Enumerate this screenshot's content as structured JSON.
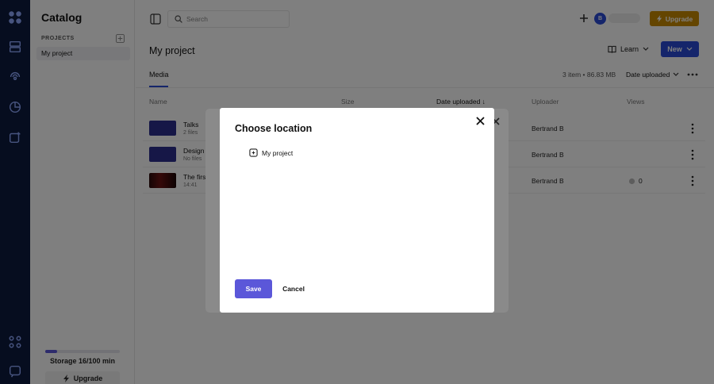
{
  "app": {
    "name": "Catalog"
  },
  "sidebar": {
    "projects_label": "PROJECTS",
    "project": "My project",
    "storage": {
      "label": "Storage 16/100 min",
      "used_fraction": 0.16
    },
    "upgrade_label": "Upgrade"
  },
  "topbar": {
    "search_placeholder": "Search",
    "avatar_initial": "B",
    "upgrade_label": "Upgrade"
  },
  "main": {
    "title": "My project",
    "learn_label": "Learn",
    "new_label": "New",
    "tab": "Media",
    "summary": "3 item • 86.83 MB",
    "sort_label": "Date uploaded",
    "columns": [
      "Name",
      "Size",
      "Date uploaded",
      "Uploader",
      "Views"
    ],
    "rows": [
      {
        "name": "Talks",
        "sub": "2 files",
        "uploader": "Bertrand B",
        "views": "",
        "kind": "folder"
      },
      {
        "name": "Design",
        "sub": "No files",
        "uploader": "Bertrand B",
        "views": "",
        "kind": "folder"
      },
      {
        "name": "The first",
        "sub": "14:41",
        "uploader": "Bertrand B",
        "views": "0",
        "kind": "video"
      }
    ]
  },
  "modal": {
    "title": "Choose location",
    "location": "My project",
    "save_label": "Save",
    "cancel_label": "Cancel"
  },
  "colors": {
    "rail": "#0d1b3e",
    "primary": "#2a4bd7",
    "save": "#5b57d9",
    "upgrade": "#c98a00"
  }
}
